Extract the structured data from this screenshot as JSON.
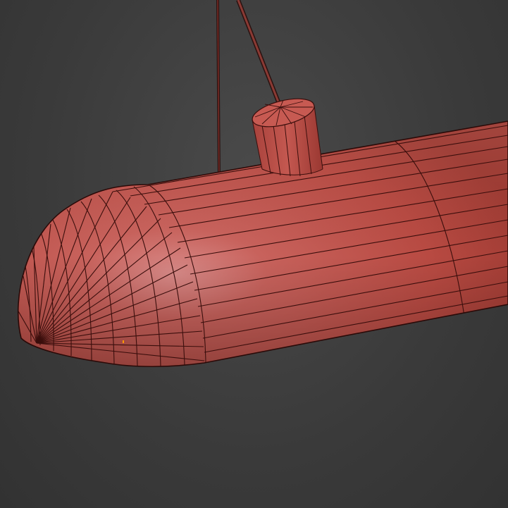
{
  "viewport": {
    "name": "3d-viewport",
    "background_color": "#3f3f3f"
  },
  "model": {
    "object": "pendant-lamp-capsule",
    "shading": "wireframe-over-smooth",
    "body_color": "#c0504a",
    "body_highlight": "#d98a8a",
    "wire_color": "#3a0e0c",
    "vertex_marker_color": "#ff9900"
  }
}
